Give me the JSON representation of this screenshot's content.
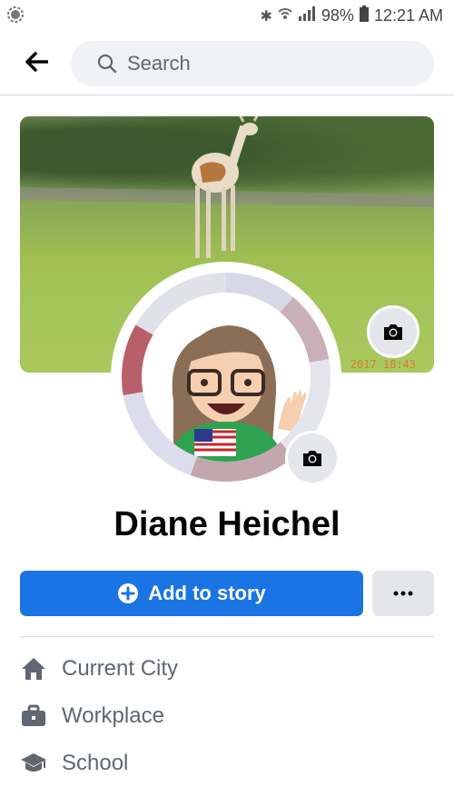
{
  "status_bar": {
    "battery": "98%",
    "time": "12:21 AM"
  },
  "header": {
    "search_placeholder": "Search"
  },
  "cover": {
    "timestamp": "2017 18:43"
  },
  "profile": {
    "name": "Diane Heichel"
  },
  "actions": {
    "add_story_label": "Add to story",
    "more_label": "···"
  },
  "details": [
    {
      "label": "Current City",
      "icon": "home-icon"
    },
    {
      "label": "Workplace",
      "icon": "briefcase-icon"
    },
    {
      "label": "School",
      "icon": "graduation-cap-icon"
    }
  ],
  "colors": {
    "accent": "#1b74e4",
    "secondary_button": "#e4e6eb",
    "muted_text": "#606770"
  }
}
